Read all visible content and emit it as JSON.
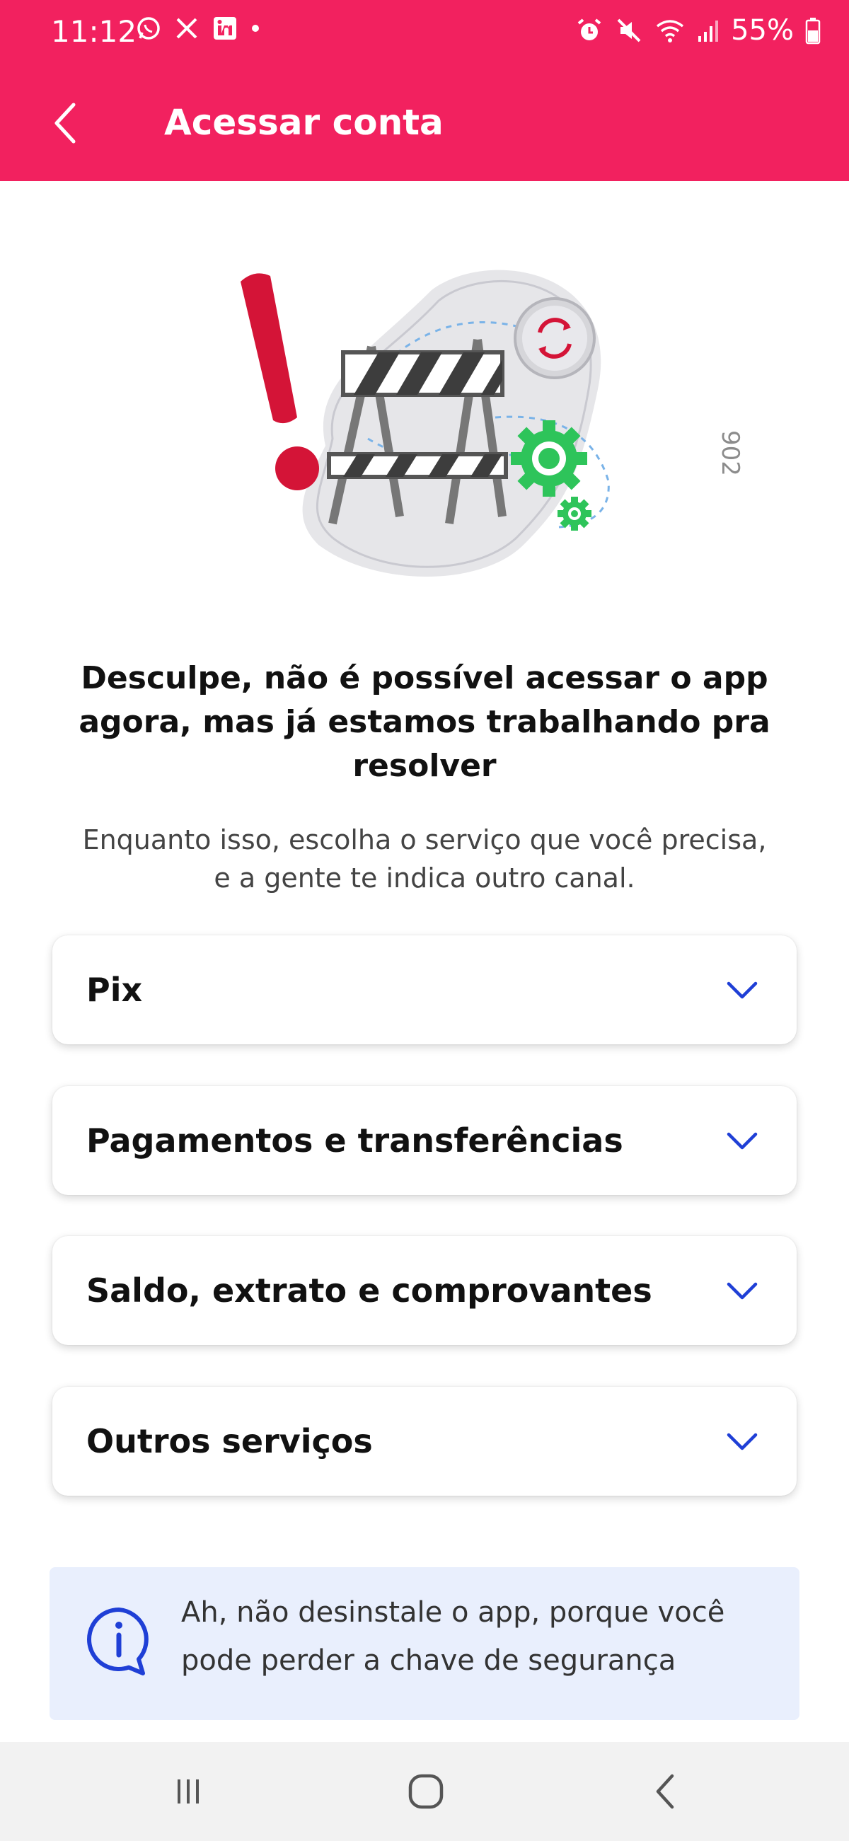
{
  "status_bar": {
    "time": "11:12",
    "battery": "55%",
    "icons_left": [
      "whatsapp-icon",
      "x-icon",
      "linkedin-icon",
      "dot-icon"
    ],
    "icons_right": [
      "alarm-icon",
      "mute-icon",
      "wifi-icon",
      "signal-icon",
      "battery-icon"
    ]
  },
  "app_bar": {
    "title": "Acessar conta",
    "back_icon": "chevron-left-icon",
    "color": "#f2215f"
  },
  "illustration": {
    "build_code": "902"
  },
  "message": {
    "heading_lines": [
      "Desculpe, não é possível acessar o app",
      "agora, mas já estamos trabalhando pra",
      "resolver"
    ],
    "subtext_lines": [
      "Enquanto isso, escolha o serviço que você precisa,",
      "e a gente te indica outro canal."
    ]
  },
  "services": [
    {
      "label": "Pix"
    },
    {
      "label": "Pagamentos e transferências"
    },
    {
      "label": "Saldo, extrato e comprovantes"
    },
    {
      "label": "Outros serviços"
    }
  ],
  "info": {
    "lines": [
      "Ah, não desinstale o app, porque você",
      "pode perder a chave de segurança"
    ],
    "icon": "info-icon",
    "accent": "#1f3fd6",
    "background": "#e9effd"
  },
  "nav": {
    "icons": [
      "recent-apps-icon",
      "home-icon",
      "back-icon"
    ]
  }
}
